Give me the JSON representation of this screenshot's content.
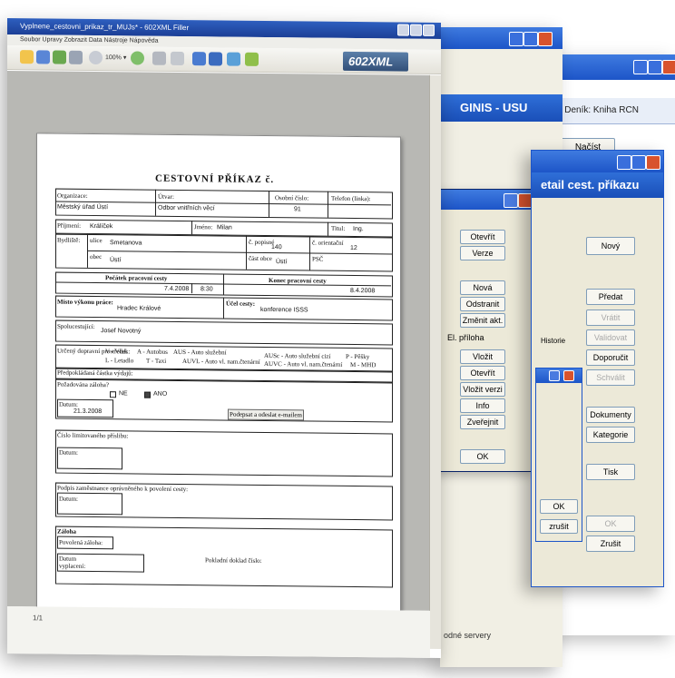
{
  "main_window": {
    "title": "Vyplnene_cestovni_prikaz_tr_MUJs* - 602XML Filler",
    "menu": "Soubor  Upravy  Zobrazit  Data  Nástroje  Nápověda",
    "zoom": "100% ▾",
    "logo_text": "602XML",
    "page_indicator": "1/1"
  },
  "form": {
    "title": "CESTOVNÍ PŘÍKAZ č.",
    "organizace_label": "Organizace:",
    "organizace_value": "Městský úřad Ústí",
    "utvar_label": "Útvar:",
    "utvar_value": "Odbor vnitřních věcí",
    "osobni_cislo_label": "Osobní číslo:",
    "osobni_cislo_value": "91",
    "telefon_label": "Telefon (linka):",
    "prijmeni_label": "Příjmení:",
    "prijmeni_value": "Králíček",
    "jmeno_label": "Jméno:",
    "jmeno_value": "Milan",
    "titul_label": "Titul:",
    "titul_value": "Ing.",
    "bydliste_label": "Bydliště:",
    "ulice_label": "ulice",
    "ulice_value": "Smetanova",
    "cislo_popisne_label": "č. popisné",
    "cislo_popisne_value": "140",
    "cislo_orientacni_label": "č. orientační",
    "cislo_orientacni_value": "12",
    "obec_label": "obec",
    "obec_value": "Ústí",
    "cast_obce_label": "část obce",
    "cast_obce_value": "Ústí",
    "psc_label": "PSČ",
    "pocatek_label": "Počátek pracovní cesty",
    "pocatek_datum": "7.4.2008",
    "pocatek_cas": "8:30",
    "konec_label": "Konec pracovní cesty",
    "konec_datum": "8.4.2008",
    "misto_vykonu_label": "Místo výkonu práce:",
    "misto_vykonu_value": "Hradec Králové",
    "ucel_label": "Účel cesty:",
    "ucel_value": "konference ISSS",
    "spolucestujici_label": "Spolucestující:",
    "spolucestujici_value": "Josef Novotný",
    "doprava_label": "Určený dopravní prostředek:",
    "doprava_opts": [
      "V - Vlak",
      "A - Autobus",
      "AUS - Auto služební",
      "AUSc - Auto služební cizí",
      "P - Pěšky",
      "L - Letadlo",
      "T - Taxi",
      "AUVL - Auto vl. nam.čtenární",
      "AUVC - Auto vl. nam.čtenární",
      "M - MHD"
    ],
    "predpokladana_label": "Předpokládaná částka výdajů:",
    "poskytnuta_label": "Požadována záloha?",
    "ne_label": "NE",
    "ano_label": "ANO",
    "datum_label": "Datum:",
    "datum_value": "21.3.2008",
    "podepsat_label": "Podepsat a odeslat e-mailem",
    "cislo_limitovaneho_label": "Číslo limitovaného příslibu:",
    "datum2_label": "Datum:",
    "podpis_label": "Podpis zaměstnance oprávněného k povolení cesty:",
    "datum3_label": "Datum:",
    "zaloha_label": "Záloha",
    "povolena_zaloha_label": "Povolená záloha:",
    "datum_vyplaceni_label": "Datum vyplacení:",
    "pokladni_doklad_label": "Pokladní doklad číslo:"
  },
  "ginis_window": {
    "band_title": "GINIS - USU",
    "footer_text": "odné servery"
  },
  "ginis_dialog": {
    "buttons": [
      "Otevřít",
      "Verze",
      "Nová",
      "Odstranit",
      "Změnit akt.",
      "Vložit",
      "Otevřít",
      "Vložit verzi",
      "Info",
      "Zveřejnit",
      "OK"
    ],
    "section_label": "El. příloha"
  },
  "back_window": {
    "subbar_text": "001, Deník: Kniha RCN",
    "nacist_label": "Načíst"
  },
  "detail_window": {
    "band_title": "etail cest. příkazu",
    "buttons": [
      {
        "label": "Nový",
        "enabled": true
      },
      {
        "label": "Předat",
        "enabled": true
      },
      {
        "label": "Vrátit",
        "enabled": false
      },
      {
        "label": "Validovat",
        "enabled": false
      },
      {
        "label": "Doporučit",
        "enabled": true
      },
      {
        "label": "Schválit",
        "enabled": false
      },
      {
        "label": "Dokumenty",
        "enabled": true
      },
      {
        "label": "Kategorie",
        "enabled": true
      },
      {
        "label": "Tisk",
        "enabled": true
      },
      {
        "label": "OK",
        "enabled": false
      },
      {
        "label": "Zrušit",
        "enabled": true
      }
    ],
    "historie_label": "Historie"
  },
  "small_dialog": {
    "ok_label": "OK",
    "zrusit_label": "zrušit"
  },
  "colors": {
    "xp_title": "#1d55c8",
    "xp_close": "#d8532d",
    "dialog_bg": "#ece9d8"
  }
}
